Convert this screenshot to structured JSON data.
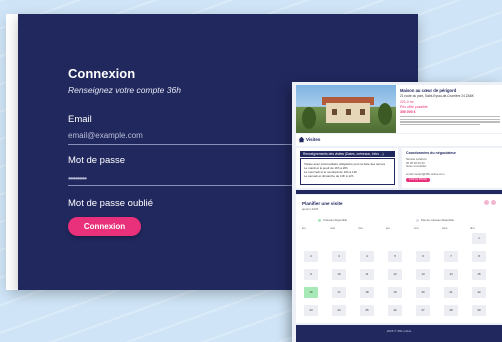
{
  "login": {
    "title": "Connexion",
    "subtitle": "Renseignez votre compte 36h",
    "email_label": "Email",
    "email_placeholder": "email@example.com",
    "password_label": "Mot de passe",
    "password_value": "••••••••••",
    "forgot_label": "Mot de passe oublié",
    "submit_label": "Connexion"
  },
  "colors": {
    "navy": "#21285e",
    "accent_pink": "#e8317a",
    "background": "#cfe5f7",
    "selected_day": "#a6e8b6"
  },
  "app": {
    "listing": {
      "title": "Maison au cœur de périgord",
      "address": "21 route du pont, Saint-Eyrau-de-Crumière 24 ZA6K",
      "size": "221.4 m²",
      "price_label": "Prix offre possible",
      "price": "350 000 €"
    },
    "visits_label": "Visites",
    "info_panel": {
      "header": "Renseignements des visites (Dates, créneaux, infos ...)",
      "lines": [
        "Visites avec intermédiaire obligatoire pour la date des termes",
        "Le mardi et le jeudi de 16h à 20h",
        "Le mercredi et le vendredi de 10h à 12h",
        "Le samedi et dimanche de 10h à 12h"
      ]
    },
    "contact_panel": {
      "title": "Coordonnées du négociateur",
      "lines": [
        "Nicolas Lefebvre",
        "06 00 00 00 00",
        "Notre Immobilier",
        "",
        "email.contact@36h-online.com"
      ],
      "button_label": "VOIR LE PROFIL"
    },
    "calendar": {
      "title": "Planifier une visite",
      "month": "janvier 2025",
      "legend_available": "Créneau disponible",
      "legend_unavailable": "Pas de créneau disponible",
      "weekdays": [
        "lun.",
        "mar.",
        "mer.",
        "jeu.",
        "ven.",
        "sam.",
        "dim."
      ],
      "days": [
        "1",
        "2",
        "3",
        "4",
        "5",
        "6",
        "7",
        "8",
        "9",
        "10",
        "11",
        "12",
        "13",
        "14",
        "15",
        "16",
        "17",
        "18",
        "19",
        "20",
        "21",
        "22",
        "23",
        "24",
        "25",
        "26",
        "27",
        "28",
        "29"
      ],
      "selected_day": "16"
    },
    "footer": "2025 © 36h-online"
  }
}
